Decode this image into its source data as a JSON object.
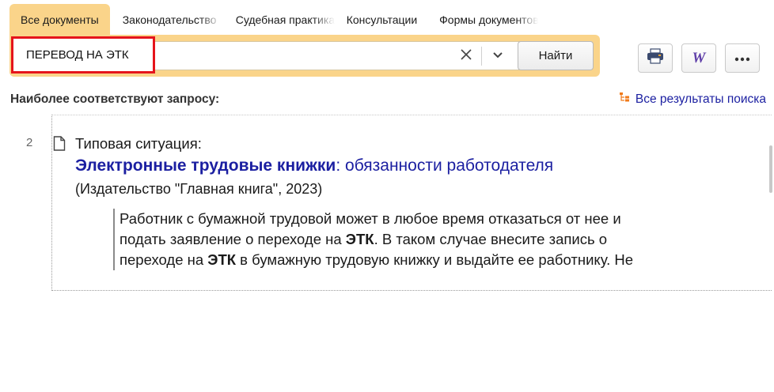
{
  "tabs": [
    {
      "label": "Все документы"
    },
    {
      "label": "Законодательство"
    },
    {
      "label": "Судебная практика"
    },
    {
      "label": "Консультации"
    },
    {
      "label": "Формы документов"
    }
  ],
  "search": {
    "query": "ПЕРЕВОД НА ЭТК",
    "find_label": "Найти",
    "clear_icon": "close-icon",
    "dropdown_icon": "chevron-down-icon"
  },
  "toolbar": {
    "print_icon": "printer-icon",
    "word_label": "W",
    "more_icon": "ellipsis-icon"
  },
  "results_header": {
    "title": "Наиболее соответствуют запросу:",
    "all_results_label": "Все результаты поиска"
  },
  "results": [
    {
      "number": "2",
      "type_label": "Типовая ситуация:",
      "title_strong": "Электронные трудовые книжки",
      "title_rest": ": обязанности работодателя",
      "source": "(Издательство \"Главная книга\", 2023)",
      "snippet": [
        {
          "text": "Работник с бумажной трудовой может в любое время отказаться от нее и"
        },
        {
          "pre": "подать заявление о переходе на ",
          "hl": "ЭТК",
          "post": ". В таком случае внесите запись о"
        },
        {
          "pre": "переходе на ",
          "hl": "ЭТК",
          "post": " в бумажную трудовую книжку и выдайте ее работнику. Не"
        }
      ]
    }
  ],
  "colors": {
    "accent": "#fad48a",
    "link": "#1b1fa1",
    "highlight_border": "#e5141b",
    "word_icon": "#5f3fa8"
  }
}
